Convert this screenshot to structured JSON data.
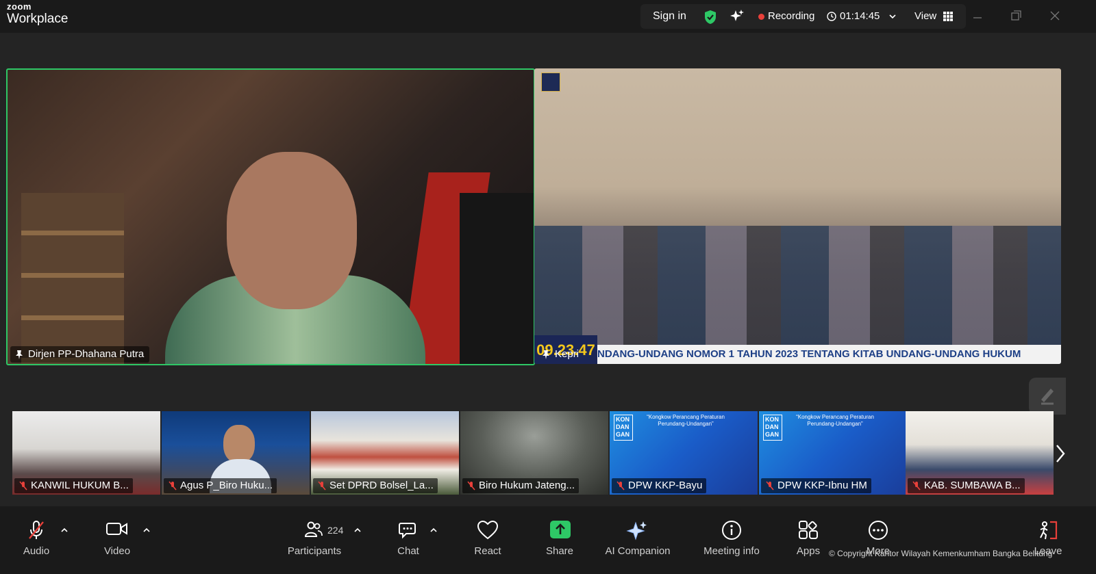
{
  "app": {
    "brand_top": "zoom",
    "brand_bottom": "Workplace"
  },
  "titlebar": {
    "sign_in": "Sign in",
    "recording": "Recording",
    "timer": "01:14:45",
    "view": "View"
  },
  "main_videos": [
    {
      "name": "Dirjen PP-Dhahana Putra"
    },
    {
      "name": "Kepri",
      "ticker_time": "09.23.47",
      "ticker_text": "NDANG-UNDANG NOMOR 1 TAHUN 2023 TENTANG KITAB UNDANG-UNDANG HUKUM"
    }
  ],
  "thumbnails": [
    {
      "name": "KANWIL HUKUM B..."
    },
    {
      "name": "Agus P_Biro Huku..."
    },
    {
      "name": "Set DPRD Bolsel_La..."
    },
    {
      "name": "Biro Hukum Jateng..."
    },
    {
      "name": "DPW KKP-Bayu",
      "slide_logo": "KON DAN GAN",
      "slide_title": "“Kongkow Perancang Peraturan Perundang-Undangan”"
    },
    {
      "name": "DPW KKP-Ibnu HM",
      "slide_logo": "KON DAN GAN",
      "slide_title": "“Kongkow Perancang Peraturan Perundang-Undangan”"
    },
    {
      "name": "KAB. SUMBAWA B..."
    }
  ],
  "toolbar": {
    "audio": "Audio",
    "video": "Video",
    "participants": "Participants",
    "participants_count": "224",
    "chat": "Chat",
    "react": "React",
    "share": "Share",
    "ai_companion": "AI Companion",
    "meeting_info": "Meeting info",
    "apps": "Apps",
    "more": "More",
    "leave": "Leave"
  },
  "watermark": "© Copyright Kantor Wilayah Kemenkumham Bangka Belitung",
  "colors": {
    "active_speaker_border": "#2ec866",
    "share_green": "#2ec866",
    "recording_red": "#e8403a",
    "leave_red": "#e8403a"
  }
}
